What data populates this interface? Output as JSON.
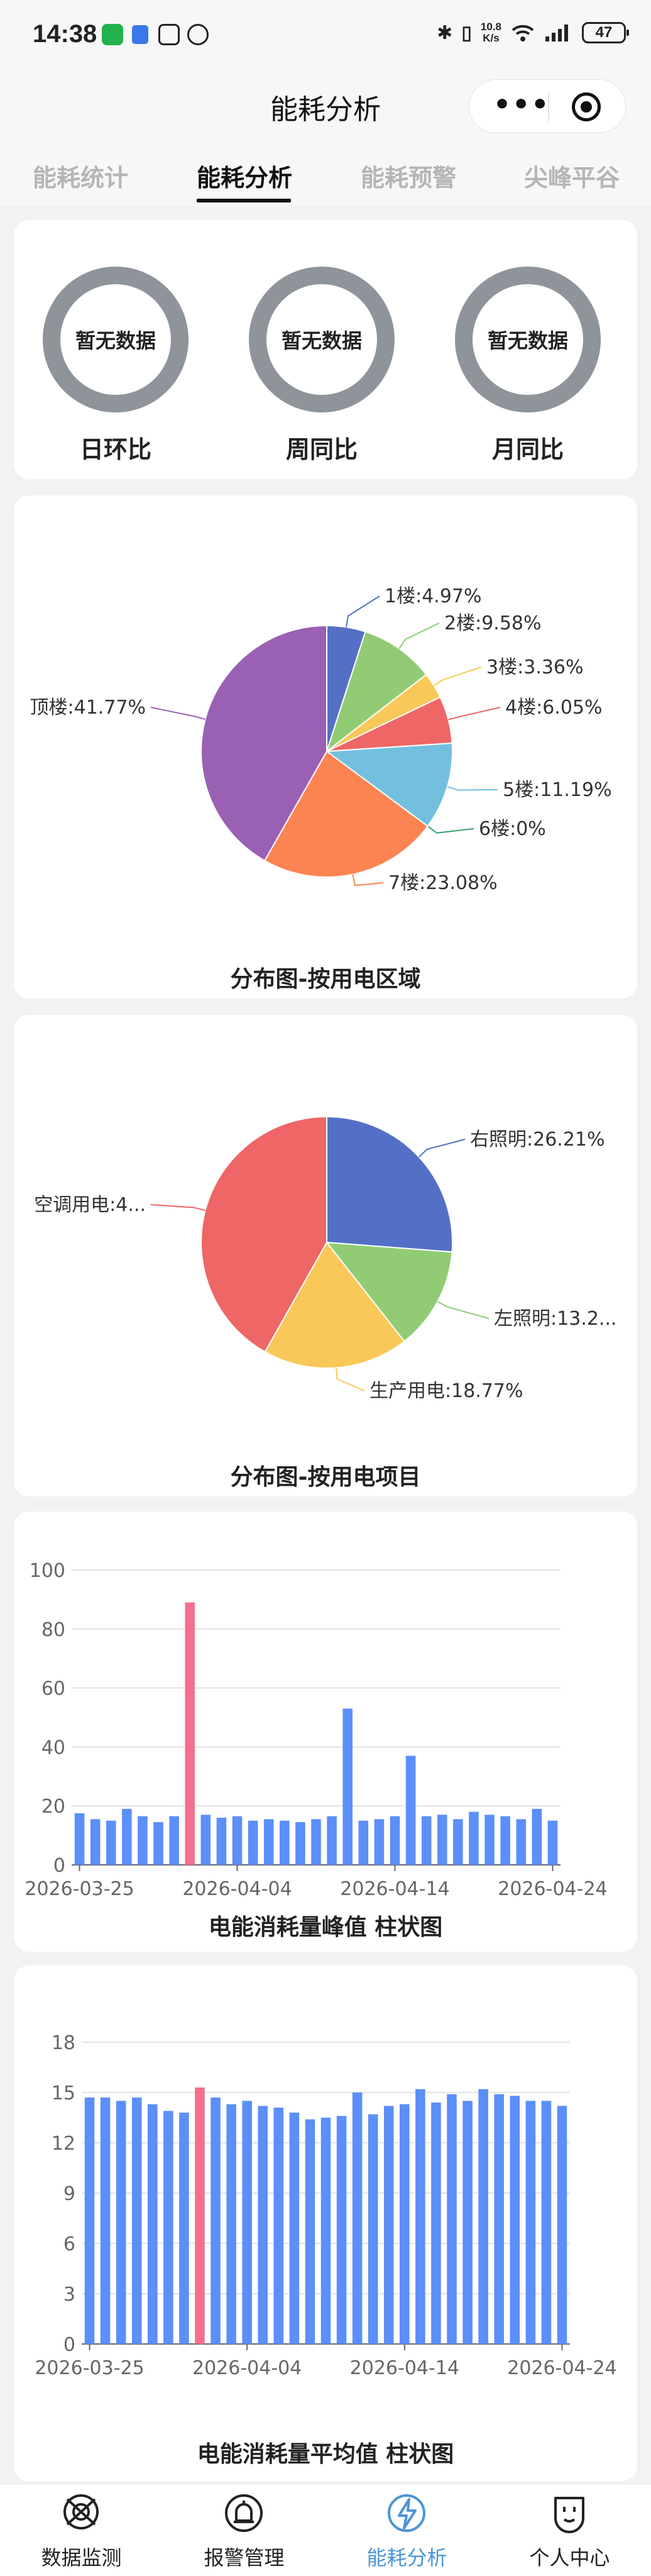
{
  "status_bar": {
    "time": "14:38",
    "network_speed": "10.8",
    "network_unit": "K/s",
    "battery": "47"
  },
  "header": {
    "title": "能耗分析"
  },
  "tabs": [
    {
      "label": "能耗统计"
    },
    {
      "label": "能耗分析"
    },
    {
      "label": "能耗预警"
    },
    {
      "label": "尖峰平谷"
    }
  ],
  "comparison": {
    "empty_text": "暂无数据",
    "items": [
      {
        "label": "日环比"
      },
      {
        "label": "周同比"
      },
      {
        "label": "月同比"
      }
    ]
  },
  "chart_data": [
    {
      "type": "pie",
      "title": "分布图-按用电区域",
      "slices": [
        {
          "label": "1楼:4.97%",
          "name": "1楼",
          "value": 4.97,
          "color": "#5470c6"
        },
        {
          "label": "2楼:9.58%",
          "name": "2楼",
          "value": 9.58,
          "color": "#91cc75"
        },
        {
          "label": "3楼:3.36%",
          "name": "3楼",
          "value": 3.36,
          "color": "#fac858"
        },
        {
          "label": "4楼:6.05%",
          "name": "4楼",
          "value": 6.05,
          "color": "#ee6666"
        },
        {
          "label": "5楼:11.19%",
          "name": "5楼",
          "value": 11.19,
          "color": "#73c0de"
        },
        {
          "label": "6楼:0%",
          "name": "6楼",
          "value": 0,
          "color": "#3ba272"
        },
        {
          "label": "7楼:23.08%",
          "name": "7楼",
          "value": 23.08,
          "color": "#fc8452"
        },
        {
          "label": "顶楼:41.77%",
          "name": "顶楼",
          "value": 41.77,
          "color": "#9a60b4"
        }
      ]
    },
    {
      "type": "pie",
      "title": "分布图-按用电项目",
      "slices": [
        {
          "label": "右照明:26.21%",
          "name": "右照明",
          "value": 26.21,
          "color": "#5470c6"
        },
        {
          "label": "左照明:13.2...",
          "name": "左照明",
          "value": 13.2,
          "color": "#91cc75"
        },
        {
          "label": "生产用电:18.77%",
          "name": "生产用电",
          "value": 18.77,
          "color": "#fac858"
        },
        {
          "label": "空调用电:4...",
          "name": "空调用电",
          "value": 41.82,
          "color": "#ee6666"
        }
      ]
    },
    {
      "type": "bar",
      "title": "电能消耗量峰值 柱状图",
      "ylim": [
        0,
        100
      ],
      "yticks": [
        0,
        20,
        40,
        60,
        80,
        100
      ],
      "xtick_labels": [
        "2026-03-25",
        "2026-04-04",
        "2026-04-14",
        "2026-04-24"
      ],
      "xtick_index": [
        0,
        10,
        20,
        30
      ],
      "base_color": "#5b8ff9",
      "highlight_color": "#f4708e",
      "highlight_index": 7,
      "values": [
        17.5,
        15.5,
        15,
        19,
        16.5,
        14.5,
        16.5,
        89,
        17,
        16,
        16.5,
        15,
        15.5,
        15,
        14.5,
        15.5,
        16.5,
        53,
        15,
        15.5,
        16.5,
        37,
        16.5,
        17,
        15.5,
        18,
        17,
        16.5,
        15.5,
        19,
        15
      ]
    },
    {
      "type": "bar",
      "title": "电能消耗量平均值 柱状图",
      "ylim": [
        0,
        18
      ],
      "yticks": [
        0,
        3,
        6,
        9,
        12,
        15,
        18
      ],
      "xtick_labels": [
        "2026-03-25",
        "2026-04-04",
        "2026-04-14",
        "2026-04-24"
      ],
      "xtick_index": [
        0,
        10,
        20,
        30
      ],
      "base_color": "#5b8ff9",
      "highlight_color": "#f4708e",
      "highlight_index": 7,
      "values": [
        14.7,
        14.7,
        14.5,
        14.7,
        14.3,
        13.9,
        13.8,
        15.3,
        14.7,
        14.3,
        14.5,
        14.2,
        14.1,
        13.8,
        13.4,
        13.5,
        13.6,
        15.0,
        13.7,
        14.2,
        14.3,
        15.2,
        14.4,
        14.9,
        14.5,
        15.2,
        14.9,
        14.8,
        14.5,
        14.5,
        14.2
      ]
    }
  ],
  "bottom_nav": [
    {
      "label": "数据监测",
      "icon": "monitor-icon"
    },
    {
      "label": "报警管理",
      "icon": "alarm-icon"
    },
    {
      "label": "能耗分析",
      "icon": "lightning-icon"
    },
    {
      "label": "个人中心",
      "icon": "person-icon"
    }
  ],
  "colors": {
    "active_nav": "#4a95d6",
    "ring": "#8f949b"
  }
}
